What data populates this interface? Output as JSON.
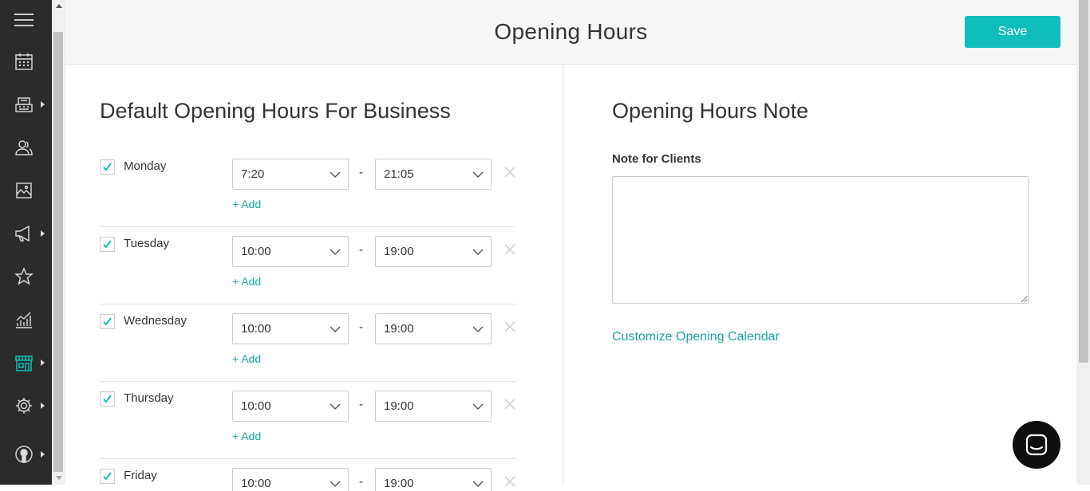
{
  "header": {
    "title": "Opening Hours",
    "save_label": "Save"
  },
  "sidebar": {
    "items": [
      {
        "icon": "menu-icon"
      },
      {
        "icon": "calendar-icon"
      },
      {
        "icon": "register-icon",
        "has_submenu": true
      },
      {
        "icon": "clients-icon"
      },
      {
        "icon": "gallery-icon"
      },
      {
        "icon": "megaphone-icon",
        "has_submenu": true
      },
      {
        "icon": "star-icon"
      },
      {
        "icon": "stats-icon"
      },
      {
        "icon": "store-icon",
        "has_submenu": true,
        "active": true
      },
      {
        "icon": "gear-icon",
        "has_submenu": true
      },
      {
        "icon": "account-icon",
        "has_submenu": true
      }
    ]
  },
  "left": {
    "title": "Default Opening Hours For Business",
    "add_label": "+ Add",
    "days": [
      {
        "name": "Monday",
        "checked": true,
        "from": "7:20",
        "to": "21:05"
      },
      {
        "name": "Tuesday",
        "checked": true,
        "from": "10:00",
        "to": "19:00"
      },
      {
        "name": "Wednesday",
        "checked": true,
        "from": "10:00",
        "to": "19:00"
      },
      {
        "name": "Thursday",
        "checked": true,
        "from": "10:00",
        "to": "19:00"
      },
      {
        "name": "Friday",
        "checked": true,
        "from": "10:00",
        "to": "19:00"
      }
    ],
    "separator": "-"
  },
  "right": {
    "title": "Opening Hours Note",
    "note_label": "Note for Clients",
    "note_value": "",
    "customize_link": "Customize Opening Calendar"
  },
  "colors": {
    "accent": "#10bdbd",
    "link": "#1aa5a5",
    "sidebar": "#2b2b2b"
  }
}
